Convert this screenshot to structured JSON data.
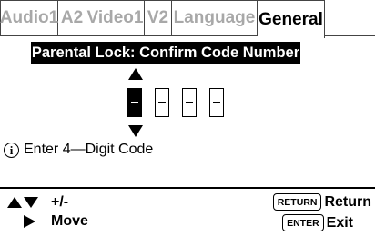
{
  "tabs": [
    {
      "label": "Audio1",
      "width": 64
    },
    {
      "label": "A2",
      "width": 31
    },
    {
      "label": "Video1",
      "width": 64
    },
    {
      "label": "V2",
      "width": 30
    },
    {
      "label": "Language",
      "width": 94
    },
    {
      "label": "General",
      "width": 74
    }
  ],
  "active_tab": "General",
  "panel": {
    "heading": "Parental Lock: Confirm Code Number",
    "code_digits": 4,
    "active_digit_index": 0,
    "info_text": "Enter 4—Digit Code",
    "info_icon": "i"
  },
  "footer": {
    "adjust_label": "+/-",
    "move_label": "Move",
    "return_key": "RETURN",
    "return_label": "Return",
    "enter_key": "ENTER",
    "exit_label": "Exit"
  }
}
